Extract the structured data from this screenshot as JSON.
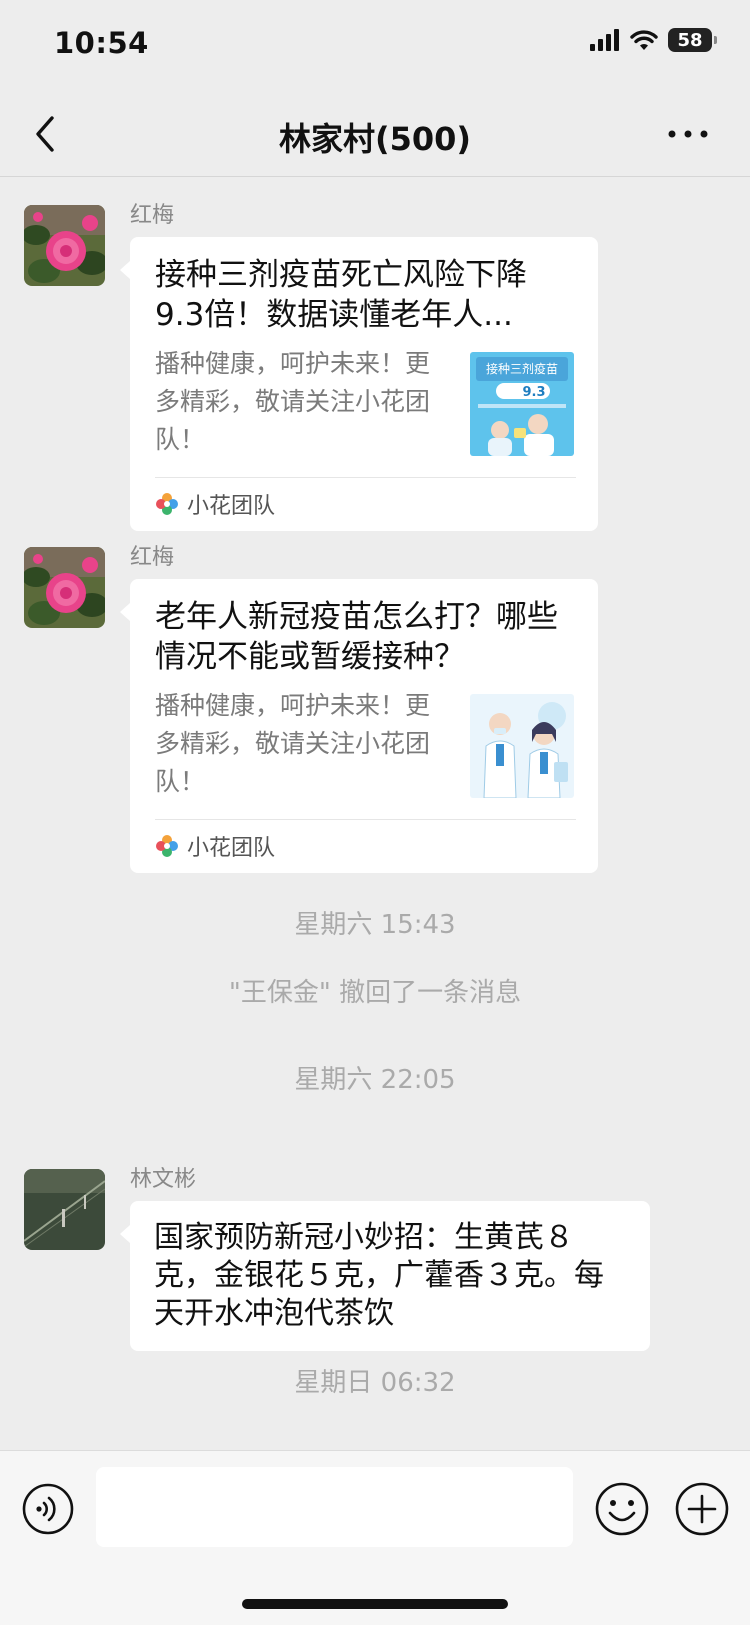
{
  "status_bar": {
    "time": "10:54",
    "battery": "58"
  },
  "nav": {
    "title": "林家村(500)"
  },
  "messages": [
    {
      "sender": "红梅",
      "card": {
        "title": "接种三剂疫苗死亡风险下降9.3倍！数据读懂老年人...",
        "description": "播种健康，呵护未来！更多精彩，敬请关注小花团队！",
        "thumbnail": {
          "heading": "接种三剂疫苗",
          "number": "9.3"
        },
        "source": "小花团队"
      }
    },
    {
      "sender": "红梅",
      "card": {
        "title": "老年人新冠疫苗怎么打？哪些情况不能或暂缓接种？",
        "description": "播种健康，呵护未来！更多精彩，敬请关注小花团队！",
        "source": "小花团队"
      }
    },
    {
      "system_time": "星期六 15:43"
    },
    {
      "system_notice": "\"王保金\" 撤回了一条消息"
    },
    {
      "system_time": "星期六 22:05"
    },
    {
      "sender": "林文彬",
      "text": "国家预防新冠小妙招：生黄芪８克，金银花５克，广藿香３克。每天开水冲泡代茶饮"
    },
    {
      "system_time": "星期日 06:32"
    }
  ],
  "input": {
    "placeholder": ""
  },
  "colors": {
    "background": "#ededed",
    "bubble": "#ffffff",
    "meta_text": "#aaaaaa"
  },
  "icons": [
    "back-arrow-icon",
    "more-dots-icon",
    "voice-icon",
    "emoji-icon",
    "plus-icon",
    "signal-icon",
    "wifi-icon",
    "battery-icon"
  ]
}
